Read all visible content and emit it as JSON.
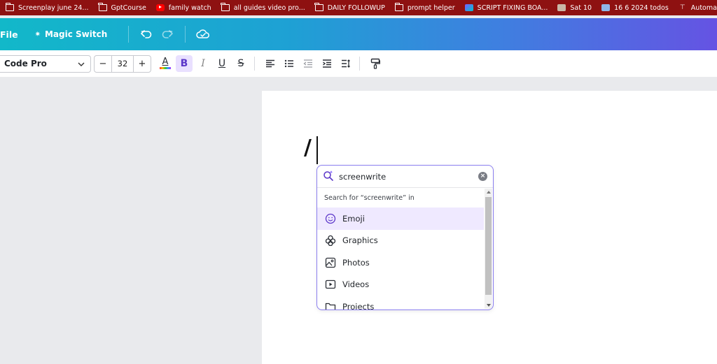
{
  "bookmarks": [
    {
      "icon": "folder-icon",
      "label": "Screenplay june 24..."
    },
    {
      "icon": "folder-icon",
      "label": "GptCourse"
    },
    {
      "icon": "youtube-icon",
      "label": "family watch"
    },
    {
      "icon": "folder-icon",
      "label": "all guides video pro..."
    },
    {
      "icon": "folder-icon",
      "label": "DAILY FOLLOWUP"
    },
    {
      "icon": "folder-icon",
      "label": "prompt helper"
    },
    {
      "icon": "canva-icon",
      "label": "SCRIPT FIXING BOA..."
    },
    {
      "icon": "photo-icon",
      "label": "Sat 10"
    },
    {
      "icon": "photo-icon",
      "label": "16 6 2024 todos"
    },
    {
      "icon": "make-icon",
      "label": "Automated Functio..."
    },
    {
      "icon": "chatgpt-icon",
      "label": ""
    }
  ],
  "header": {
    "file_label": "File",
    "magic_label": "Magic Switch"
  },
  "toolbar": {
    "font": "Code Pro",
    "size": "32",
    "minus": "−",
    "plus": "+",
    "text_color_glyph": "A",
    "bold_glyph": "B",
    "italic_glyph": "I",
    "underline_glyph": "U",
    "strike_glyph": "S"
  },
  "editor": {
    "typed_text": "/"
  },
  "popup": {
    "query": "screenwrite",
    "hint": "Search for “screenwrite” in",
    "items": [
      {
        "label": "Emoji",
        "icon": "emoji-icon",
        "selected": true
      },
      {
        "label": "Graphics",
        "icon": "graphics-icon",
        "selected": false
      },
      {
        "label": "Photos",
        "icon": "photo-icon",
        "selected": false
      },
      {
        "label": "Videos",
        "icon": "video-icon",
        "selected": false
      },
      {
        "label": "Projects",
        "icon": "folder-icon",
        "selected": false
      }
    ]
  },
  "colors": {
    "bookmark_bar": "#8e1111",
    "header_start": "#12b8c9",
    "header_end": "#6553e3",
    "accent": "#8b7ff0",
    "selected_bg": "#efe9ff"
  }
}
